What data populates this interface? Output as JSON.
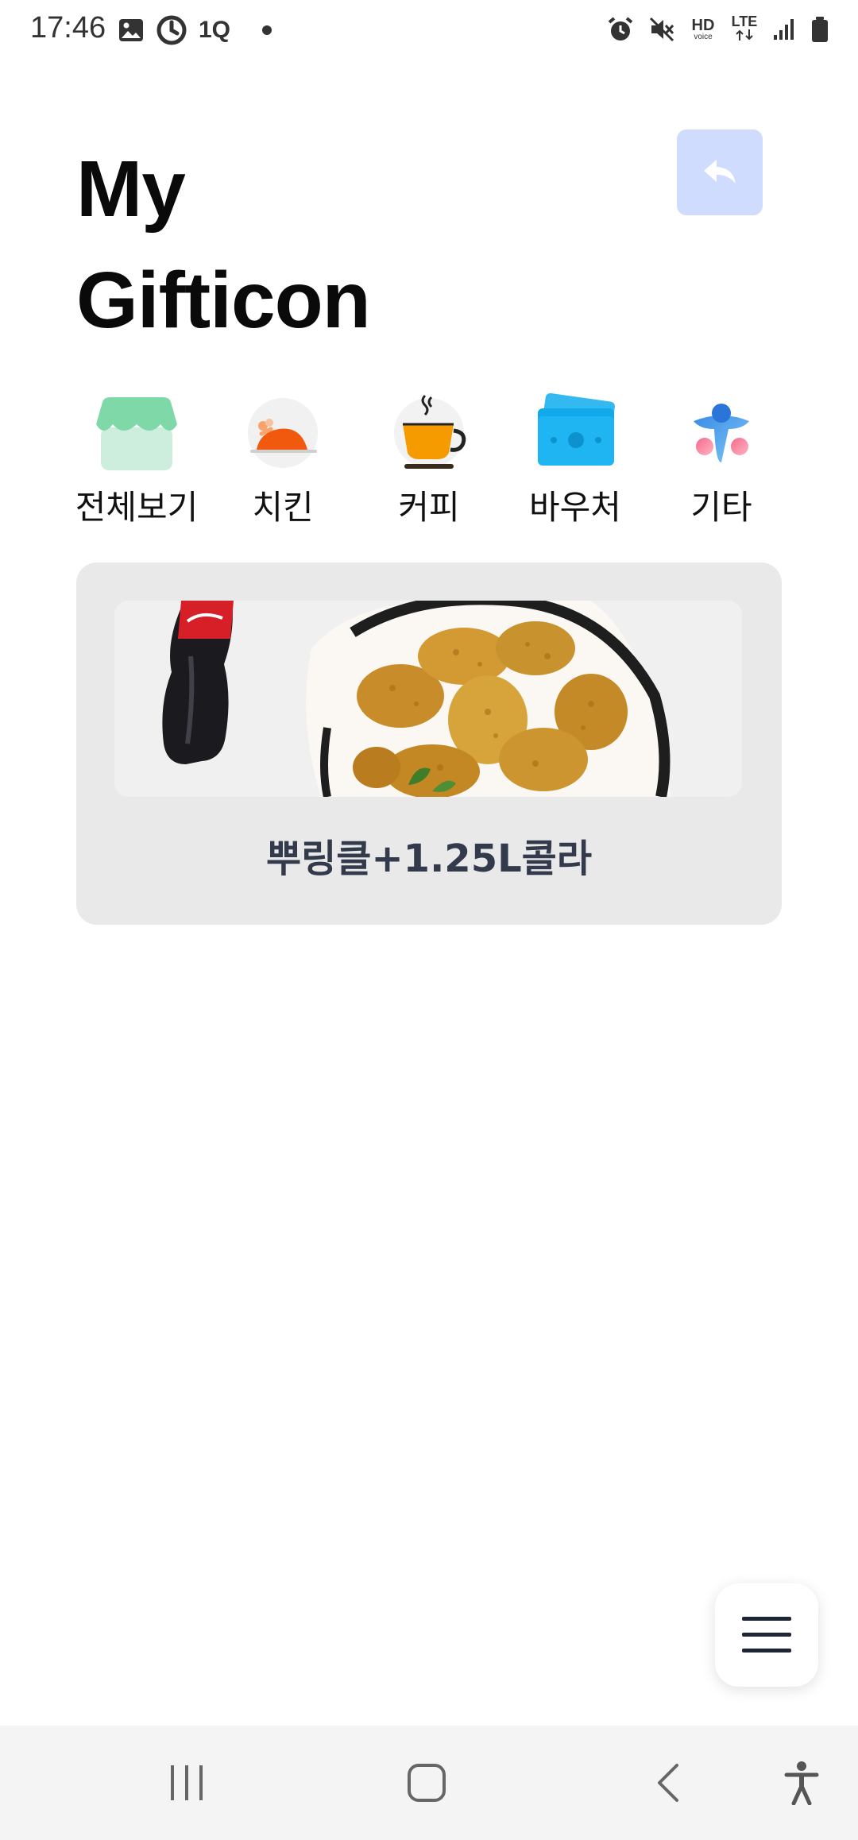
{
  "status_bar": {
    "time": "17:46",
    "left_icons": [
      "gallery-icon",
      "sync-icon",
      "app-1q-icon",
      "dot-icon"
    ],
    "left_icon_text": {
      "app_1q": "1Q"
    },
    "right_icons": [
      "alarm-icon",
      "mute-icon",
      "hd-voice-icon",
      "lte-icon",
      "signal-icon",
      "battery-icon"
    ],
    "hd_label": "HD",
    "hd_sub": "voice",
    "lte_label": "LTE"
  },
  "header": {
    "title_line1": "My",
    "title_line2": "Gifticon",
    "back_button_icon": "reply-arrow-icon",
    "back_button_color": "#cfdcfd"
  },
  "categories": [
    {
      "label": "전체보기",
      "icon": "store-icon"
    },
    {
      "label": "치킨",
      "icon": "chicken-icon"
    },
    {
      "label": "커피",
      "icon": "coffee-cup-icon"
    },
    {
      "label": "바우처",
      "icon": "voucher-icon"
    },
    {
      "label": "기타",
      "icon": "misc-icon"
    }
  ],
  "gifts": [
    {
      "title": "뿌링클+1.25L콜라",
      "image": "chicken-and-cola-image"
    }
  ],
  "fab": {
    "icon": "hamburger-menu-icon"
  },
  "system_nav": {
    "items": [
      "recents-icon",
      "home-icon",
      "back-icon",
      "accessibility-icon"
    ]
  }
}
